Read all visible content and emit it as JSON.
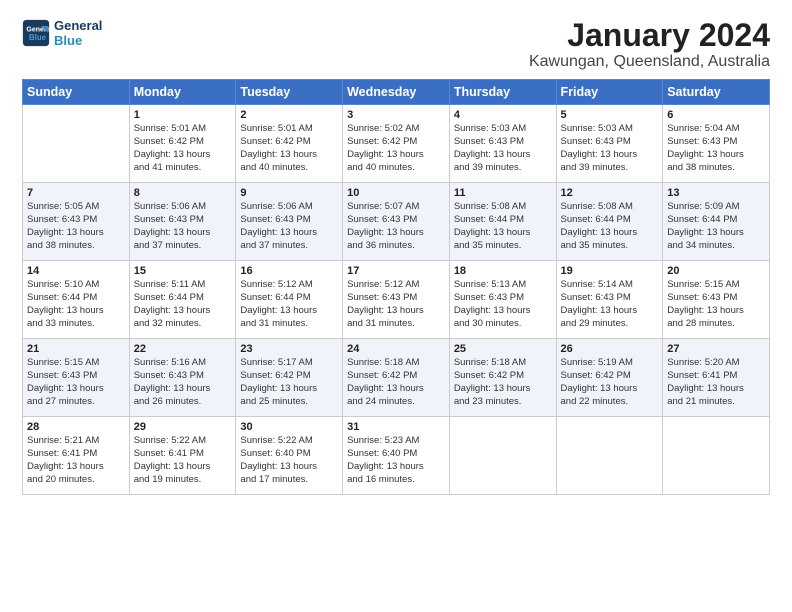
{
  "logo": {
    "line1": "General",
    "line2": "Blue"
  },
  "title": "January 2024",
  "subtitle": "Kawungan, Queensland, Australia",
  "weekdays": [
    "Sunday",
    "Monday",
    "Tuesday",
    "Wednesday",
    "Thursday",
    "Friday",
    "Saturday"
  ],
  "weeks": [
    [
      {
        "day": "",
        "sunrise": "",
        "sunset": "",
        "daylight": ""
      },
      {
        "day": "1",
        "sunrise": "5:01 AM",
        "sunset": "6:42 PM",
        "daylight": "13 hours and 41 minutes."
      },
      {
        "day": "2",
        "sunrise": "5:01 AM",
        "sunset": "6:42 PM",
        "daylight": "13 hours and 40 minutes."
      },
      {
        "day": "3",
        "sunrise": "5:02 AM",
        "sunset": "6:42 PM",
        "daylight": "13 hours and 40 minutes."
      },
      {
        "day": "4",
        "sunrise": "5:03 AM",
        "sunset": "6:43 PM",
        "daylight": "13 hours and 39 minutes."
      },
      {
        "day": "5",
        "sunrise": "5:03 AM",
        "sunset": "6:43 PM",
        "daylight": "13 hours and 39 minutes."
      },
      {
        "day": "6",
        "sunrise": "5:04 AM",
        "sunset": "6:43 PM",
        "daylight": "13 hours and 38 minutes."
      }
    ],
    [
      {
        "day": "7",
        "sunrise": "5:05 AM",
        "sunset": "6:43 PM",
        "daylight": "13 hours and 38 minutes."
      },
      {
        "day": "8",
        "sunrise": "5:06 AM",
        "sunset": "6:43 PM",
        "daylight": "13 hours and 37 minutes."
      },
      {
        "day": "9",
        "sunrise": "5:06 AM",
        "sunset": "6:43 PM",
        "daylight": "13 hours and 37 minutes."
      },
      {
        "day": "10",
        "sunrise": "5:07 AM",
        "sunset": "6:43 PM",
        "daylight": "13 hours and 36 minutes."
      },
      {
        "day": "11",
        "sunrise": "5:08 AM",
        "sunset": "6:44 PM",
        "daylight": "13 hours and 35 minutes."
      },
      {
        "day": "12",
        "sunrise": "5:08 AM",
        "sunset": "6:44 PM",
        "daylight": "13 hours and 35 minutes."
      },
      {
        "day": "13",
        "sunrise": "5:09 AM",
        "sunset": "6:44 PM",
        "daylight": "13 hours and 34 minutes."
      }
    ],
    [
      {
        "day": "14",
        "sunrise": "5:10 AM",
        "sunset": "6:44 PM",
        "daylight": "13 hours and 33 minutes."
      },
      {
        "day": "15",
        "sunrise": "5:11 AM",
        "sunset": "6:44 PM",
        "daylight": "13 hours and 32 minutes."
      },
      {
        "day": "16",
        "sunrise": "5:12 AM",
        "sunset": "6:44 PM",
        "daylight": "13 hours and 31 minutes."
      },
      {
        "day": "17",
        "sunrise": "5:12 AM",
        "sunset": "6:43 PM",
        "daylight": "13 hours and 31 minutes."
      },
      {
        "day": "18",
        "sunrise": "5:13 AM",
        "sunset": "6:43 PM",
        "daylight": "13 hours and 30 minutes."
      },
      {
        "day": "19",
        "sunrise": "5:14 AM",
        "sunset": "6:43 PM",
        "daylight": "13 hours and 29 minutes."
      },
      {
        "day": "20",
        "sunrise": "5:15 AM",
        "sunset": "6:43 PM",
        "daylight": "13 hours and 28 minutes."
      }
    ],
    [
      {
        "day": "21",
        "sunrise": "5:15 AM",
        "sunset": "6:43 PM",
        "daylight": "13 hours and 27 minutes."
      },
      {
        "day": "22",
        "sunrise": "5:16 AM",
        "sunset": "6:43 PM",
        "daylight": "13 hours and 26 minutes."
      },
      {
        "day": "23",
        "sunrise": "5:17 AM",
        "sunset": "6:42 PM",
        "daylight": "13 hours and 25 minutes."
      },
      {
        "day": "24",
        "sunrise": "5:18 AM",
        "sunset": "6:42 PM",
        "daylight": "13 hours and 24 minutes."
      },
      {
        "day": "25",
        "sunrise": "5:18 AM",
        "sunset": "6:42 PM",
        "daylight": "13 hours and 23 minutes."
      },
      {
        "day": "26",
        "sunrise": "5:19 AM",
        "sunset": "6:42 PM",
        "daylight": "13 hours and 22 minutes."
      },
      {
        "day": "27",
        "sunrise": "5:20 AM",
        "sunset": "6:41 PM",
        "daylight": "13 hours and 21 minutes."
      }
    ],
    [
      {
        "day": "28",
        "sunrise": "5:21 AM",
        "sunset": "6:41 PM",
        "daylight": "13 hours and 20 minutes."
      },
      {
        "day": "29",
        "sunrise": "5:22 AM",
        "sunset": "6:41 PM",
        "daylight": "13 hours and 19 minutes."
      },
      {
        "day": "30",
        "sunrise": "5:22 AM",
        "sunset": "6:40 PM",
        "daylight": "13 hours and 17 minutes."
      },
      {
        "day": "31",
        "sunrise": "5:23 AM",
        "sunset": "6:40 PM",
        "daylight": "13 hours and 16 minutes."
      },
      {
        "day": "",
        "sunrise": "",
        "sunset": "",
        "daylight": ""
      },
      {
        "day": "",
        "sunrise": "",
        "sunset": "",
        "daylight": ""
      },
      {
        "day": "",
        "sunrise": "",
        "sunset": "",
        "daylight": ""
      }
    ]
  ],
  "labels": {
    "sunrise_prefix": "Sunrise: ",
    "sunset_prefix": "Sunset: ",
    "daylight_prefix": "Daylight: "
  }
}
